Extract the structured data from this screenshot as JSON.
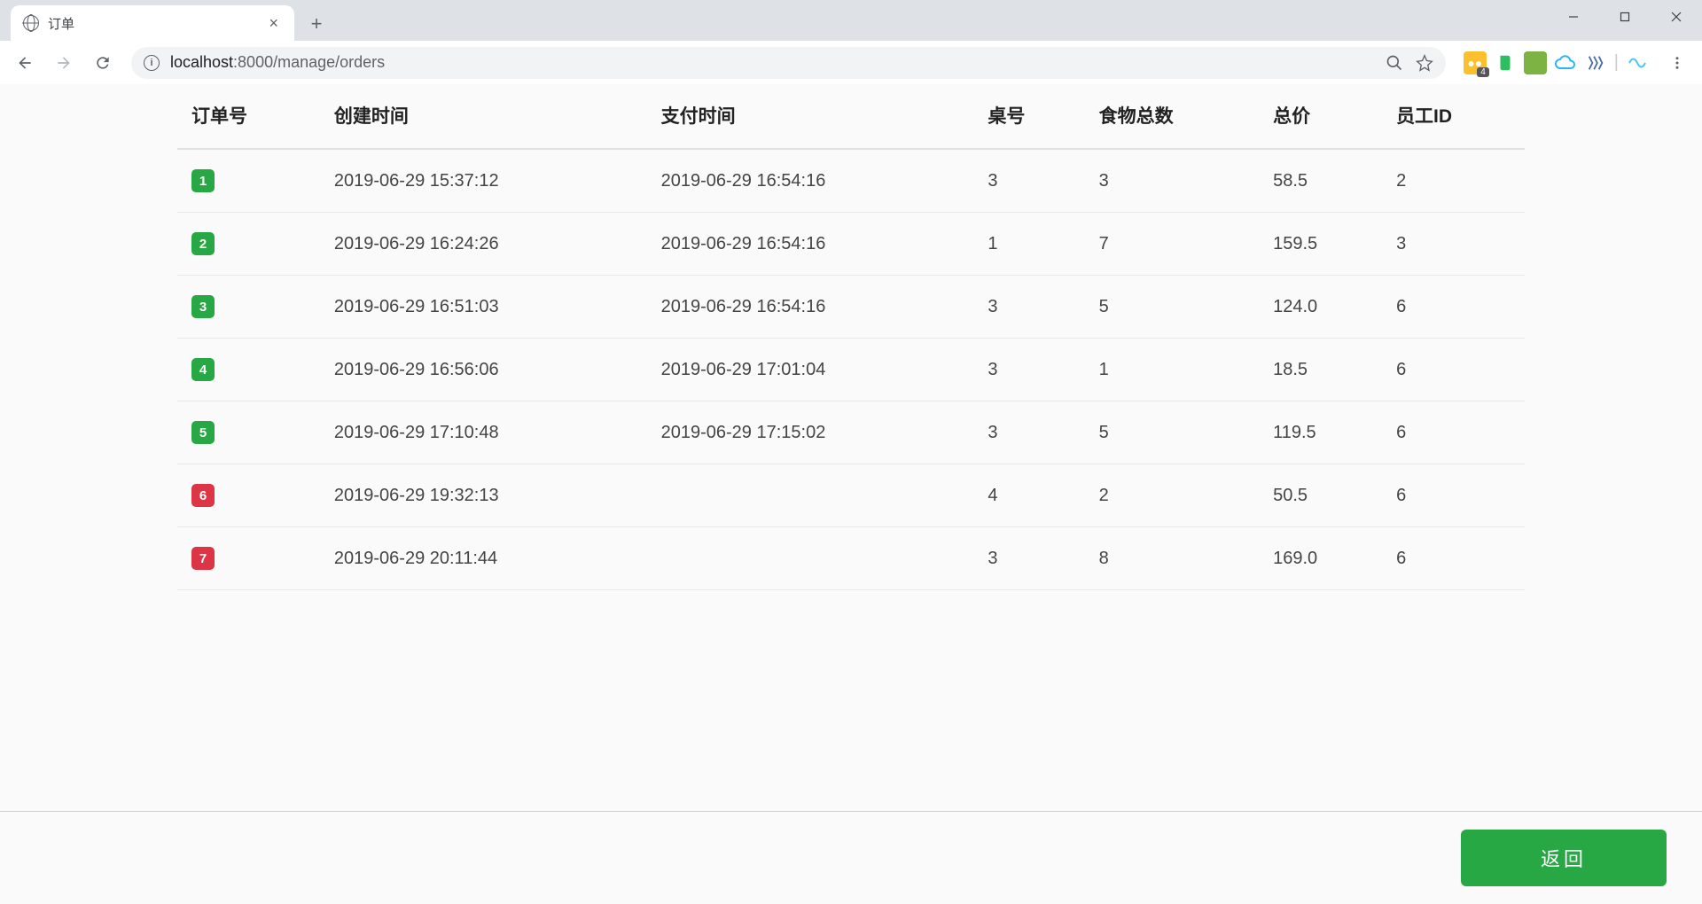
{
  "browser": {
    "tab_title": "订单",
    "url_host": "localhost",
    "url_port_path": ":8000/manage/orders",
    "ext_badge": "4"
  },
  "table": {
    "headers": {
      "order_no": "订单号",
      "created_at": "创建时间",
      "paid_at": "支付时间",
      "table_no": "桌号",
      "food_count": "食物总数",
      "total_price": "总价",
      "employee_id": "员工ID"
    },
    "rows": [
      {
        "id": "1",
        "status": "paid",
        "created_at": "2019-06-29 15:37:12",
        "paid_at": "2019-06-29 16:54:16",
        "table_no": "3",
        "food_count": "3",
        "total_price": "58.5",
        "employee_id": "2"
      },
      {
        "id": "2",
        "status": "paid",
        "created_at": "2019-06-29 16:24:26",
        "paid_at": "2019-06-29 16:54:16",
        "table_no": "1",
        "food_count": "7",
        "total_price": "159.5",
        "employee_id": "3"
      },
      {
        "id": "3",
        "status": "paid",
        "created_at": "2019-06-29 16:51:03",
        "paid_at": "2019-06-29 16:54:16",
        "table_no": "3",
        "food_count": "5",
        "total_price": "124.0",
        "employee_id": "6"
      },
      {
        "id": "4",
        "status": "paid",
        "created_at": "2019-06-29 16:56:06",
        "paid_at": "2019-06-29 17:01:04",
        "table_no": "3",
        "food_count": "1",
        "total_price": "18.5",
        "employee_id": "6"
      },
      {
        "id": "5",
        "status": "paid",
        "created_at": "2019-06-29 17:10:48",
        "paid_at": "2019-06-29 17:15:02",
        "table_no": "3",
        "food_count": "5",
        "total_price": "119.5",
        "employee_id": "6"
      },
      {
        "id": "6",
        "status": "unpaid",
        "created_at": "2019-06-29 19:32:13",
        "paid_at": "",
        "table_no": "4",
        "food_count": "2",
        "total_price": "50.5",
        "employee_id": "6"
      },
      {
        "id": "7",
        "status": "unpaid",
        "created_at": "2019-06-29 20:11:44",
        "paid_at": "",
        "table_no": "3",
        "food_count": "8",
        "total_price": "169.0",
        "employee_id": "6"
      }
    ]
  },
  "footer": {
    "return_label": "返回"
  },
  "colors": {
    "badge_paid": "#28a745",
    "badge_unpaid": "#dc3545",
    "primary_button": "#28a745"
  }
}
